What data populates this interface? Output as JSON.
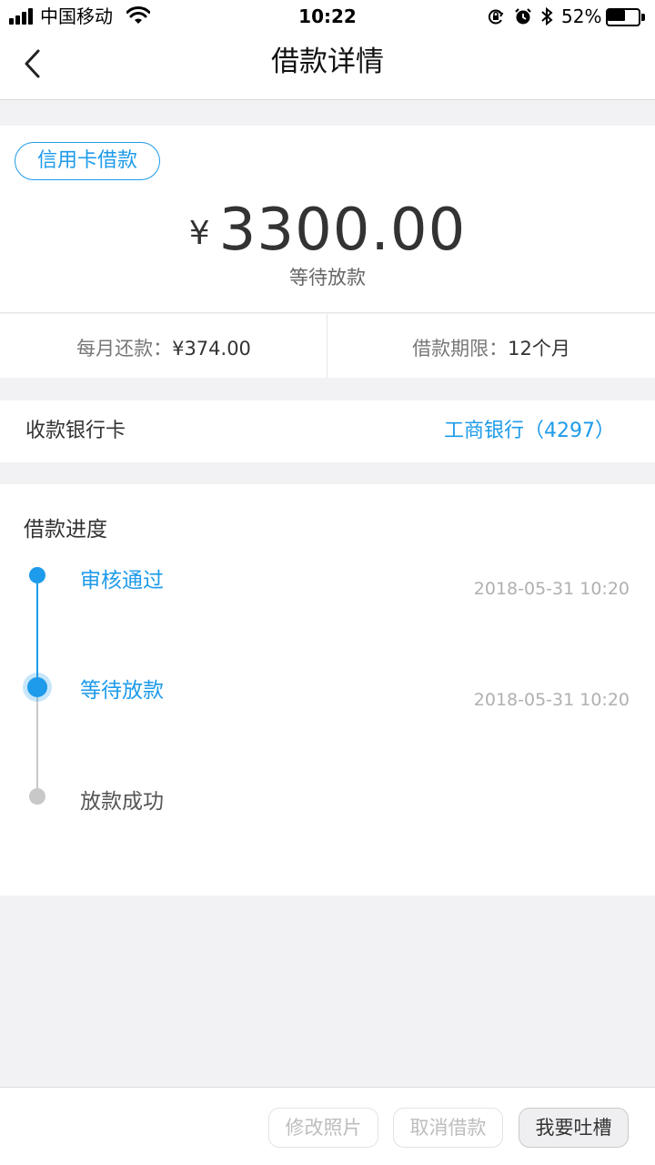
{
  "status_bar": {
    "carrier": "中国移动",
    "time": "10:22",
    "battery": "52%",
    "battery_level": 0.52,
    "icons": [
      "signal-icon",
      "wifi-icon",
      "orientation-lock-icon",
      "alarm-icon",
      "bluetooth-icon",
      "battery-icon"
    ]
  },
  "nav": {
    "title": "借款详情",
    "back_icon": "chevron-left-icon"
  },
  "loan": {
    "tag": "信用卡借款",
    "currency": "¥",
    "amount": "3300.00",
    "status": "等待放款",
    "monthly_label": "每月还款：",
    "monthly_value": "¥374.00",
    "term_label": "借款期限：",
    "term_value": "12个月"
  },
  "bank": {
    "label": "收款银行卡",
    "value": "工商银行（4297）"
  },
  "progress": {
    "title": "借款进度",
    "steps": [
      {
        "label": "审核通过",
        "time": "2018-05-31 10:20",
        "state": "done"
      },
      {
        "label": "等待放款",
        "time": "2018-05-31 10:20",
        "state": "current"
      },
      {
        "label": "放款成功",
        "time": "",
        "state": "pending"
      }
    ]
  },
  "actions": {
    "edit_photo": "修改照片",
    "cancel_loan": "取消借款",
    "feedback": "我要吐槽"
  },
  "colors": {
    "accent": "#1e9bea",
    "background": "#f2f2f4",
    "pending": "#c8c8c8"
  }
}
